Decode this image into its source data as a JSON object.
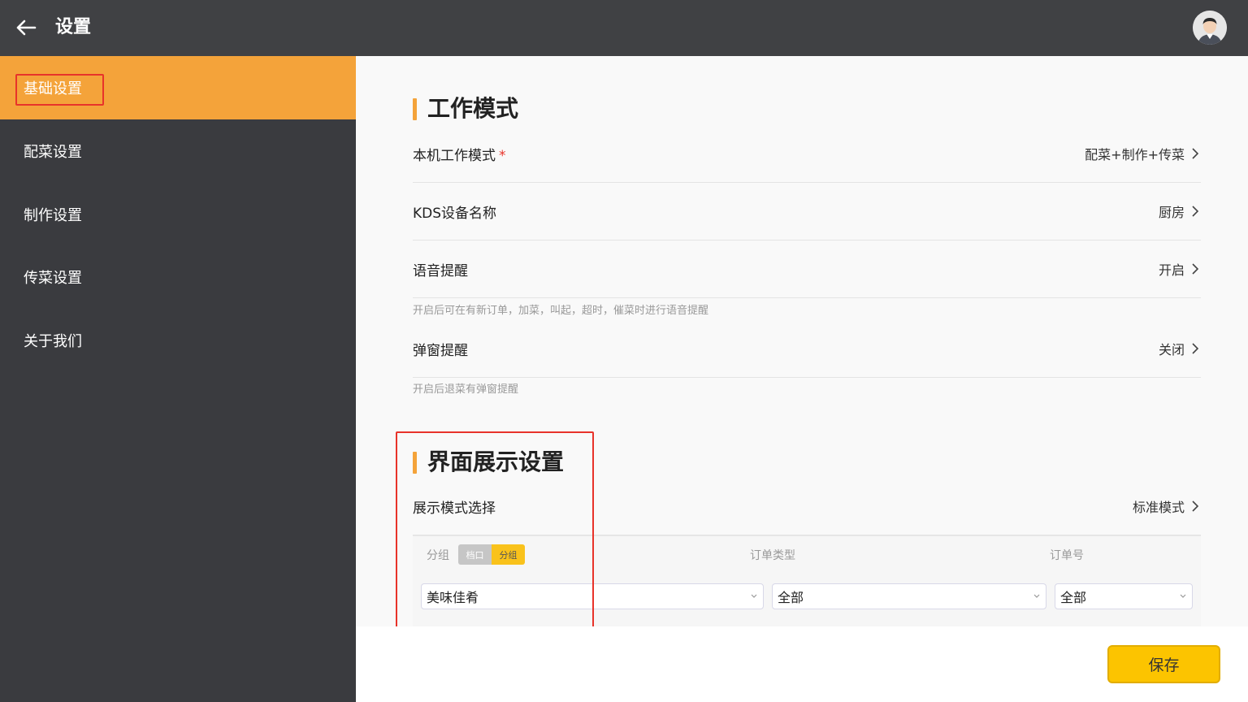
{
  "header": {
    "title": "设置"
  },
  "sidebar": {
    "items": [
      {
        "label": "基础设置",
        "active": true
      },
      {
        "label": "配菜设置"
      },
      {
        "label": "制作设置"
      },
      {
        "label": "传菜设置"
      },
      {
        "label": "关于我们"
      }
    ]
  },
  "work_mode": {
    "title": "工作模式",
    "rows": [
      {
        "label": "本机工作模式",
        "required_mark": "*",
        "value": "配菜+制作+传菜"
      },
      {
        "label": "KDS设备名称",
        "value": "厨房"
      },
      {
        "label": "语音提醒",
        "value": "开启",
        "hint": "开启后可在有新订单，加菜，叫起，超时，催菜时进行语音提醒"
      },
      {
        "label": "弹窗提醒",
        "value": "关闭",
        "hint": "开启后退菜有弹窗提醒"
      }
    ]
  },
  "display": {
    "title": "界面展示设置",
    "mode_row": {
      "label": "展示模式选择",
      "value": "标准模式"
    },
    "preview": {
      "group_label": "分组",
      "toggle": {
        "left": "档口",
        "right": "分组"
      },
      "order_type_label": "订单类型",
      "order_no_label": "订单号",
      "group_value": "美味佳肴",
      "order_type_value": "全部",
      "order_no_value": "全部"
    }
  },
  "footer": {
    "save_label": "保存"
  },
  "colors": {
    "accent": "#f4a33a",
    "save": "#fcc400",
    "highlight": "#e8332a"
  }
}
